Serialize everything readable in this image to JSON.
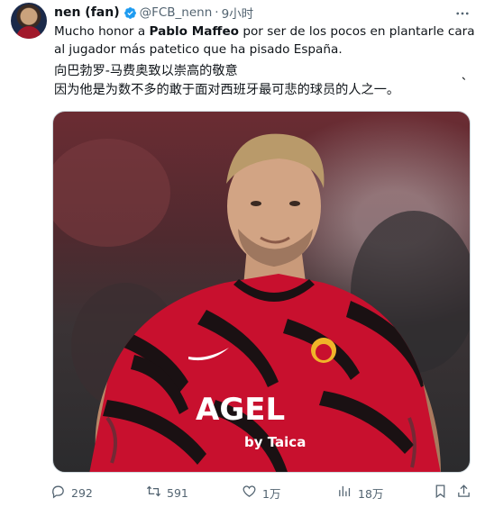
{
  "tweet": {
    "author_name": "nen (fan)",
    "handle": "@FCB_nenn",
    "separator": "·",
    "time": "9小时",
    "text_es_prefix": "Mucho honor a ",
    "text_es_bold": "Pablo Maffeo",
    "text_es_suffix": " por ser de los pocos en plantarle cara al jugador más patetico que ha pisado España.",
    "text_zh_line1": "向巴勃罗-马费奥致以崇高的敬意",
    "text_zh_mark": "、",
    "text_zh_line2": "因为他是为数不多的敢于面对西班牙最可悲的球员的人之一。",
    "image_jersey_sponsor": "AGEL",
    "image_jersey_sponsor_sub": "by Taica"
  },
  "actions": {
    "replies": "292",
    "retweets": "591",
    "likes": "1万",
    "views": "18万"
  },
  "colors": {
    "verified": "#1d9bf0",
    "muted": "#536471",
    "text": "#0f1419",
    "jersey_red": "#c8102e"
  },
  "icons": [
    "reply-icon",
    "retweet-icon",
    "like-icon",
    "views-icon",
    "bookmark-icon",
    "share-icon",
    "verified-badge-icon",
    "more-icon"
  ]
}
